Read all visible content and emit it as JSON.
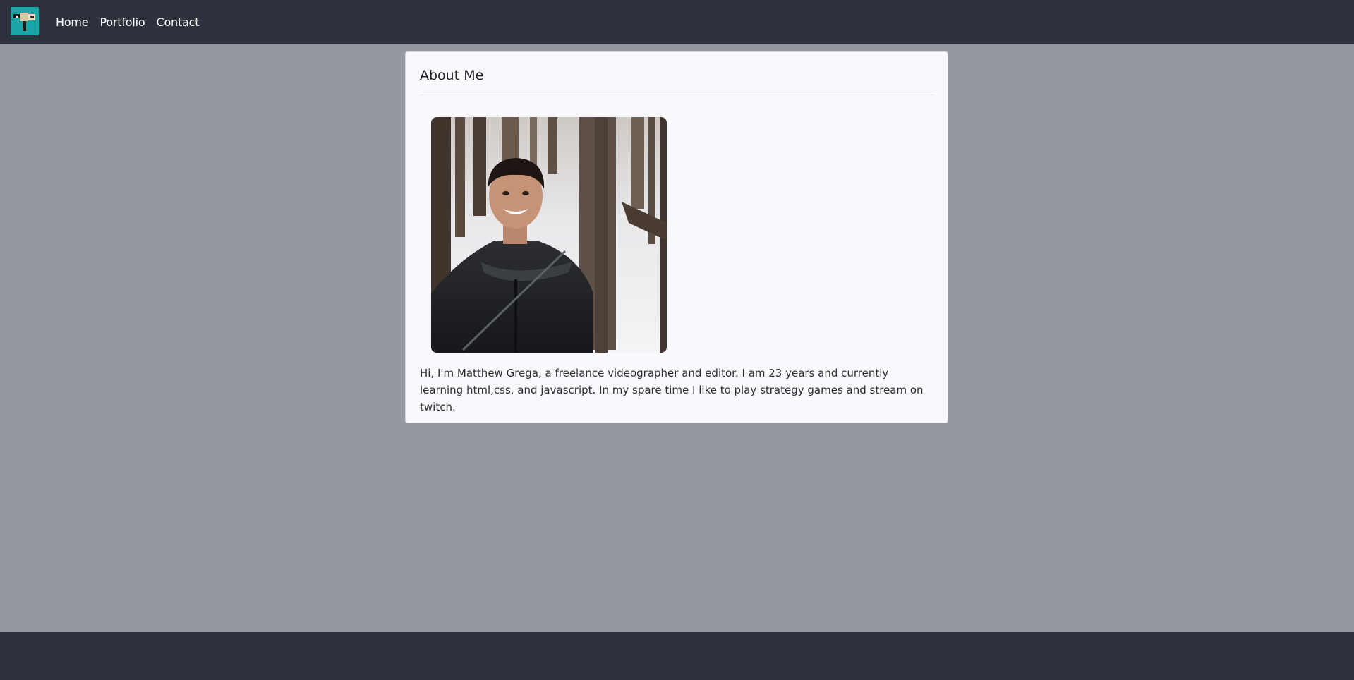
{
  "nav": {
    "brand_icon": "camcorder-logo-icon",
    "links": [
      {
        "label": "Home"
      },
      {
        "label": "Portfolio"
      },
      {
        "label": "Contact"
      }
    ]
  },
  "about": {
    "title": "About Me",
    "bio": "Hi, I'm Matthew Grega, a freelance videographer and editor. I am 23 years and currently learning html,css, and javascript. In my spare time I like to play strategy games and stream on twitch."
  },
  "colors": {
    "navbar": "#2e323d",
    "page_background": "#95989f",
    "card_background": "#f8f8fd",
    "brand_accent": "#1ba3a4"
  }
}
